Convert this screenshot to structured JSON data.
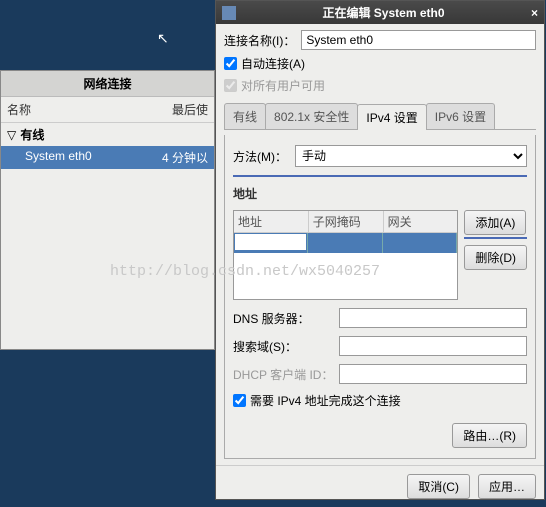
{
  "cursor_glyph": "↖",
  "bg": {
    "title": "网络连接",
    "col_name": "名称",
    "col_last": "最后使",
    "wired": "有线",
    "item": "System eth0",
    "item_time": "4 分钟以"
  },
  "dialog": {
    "title": "正在编辑 System eth0",
    "close": "×",
    "name_label": "连接名称(I)：",
    "name_value": "System eth0",
    "auto_connect": "自动连接(A)",
    "all_users": "对所有用户可用",
    "tabs": {
      "wired": "有线",
      "sec": "802.1x 安全性",
      "ipv4": "IPv4 设置",
      "ipv6": "IPv6 设置"
    },
    "method_label": "方法(M)：",
    "method_value": "手动",
    "addr_label": "地址",
    "cols": {
      "addr": "地址",
      "mask": "子网掩码",
      "gw": "网关"
    },
    "btn_add": "添加(A)",
    "btn_del": "删除(D)",
    "dns_label": "DNS 服务器：",
    "search_label": "搜索域(S)：",
    "dhcp_label": "DHCP 客户端 ID：",
    "require_ipv4": "需要 IPv4 地址完成这个连接",
    "btn_route": "路由…(R)",
    "btn_cancel": "取消(C)",
    "btn_apply": "应用…"
  },
  "watermark": "http://blog.csdn.net/wx5040257"
}
